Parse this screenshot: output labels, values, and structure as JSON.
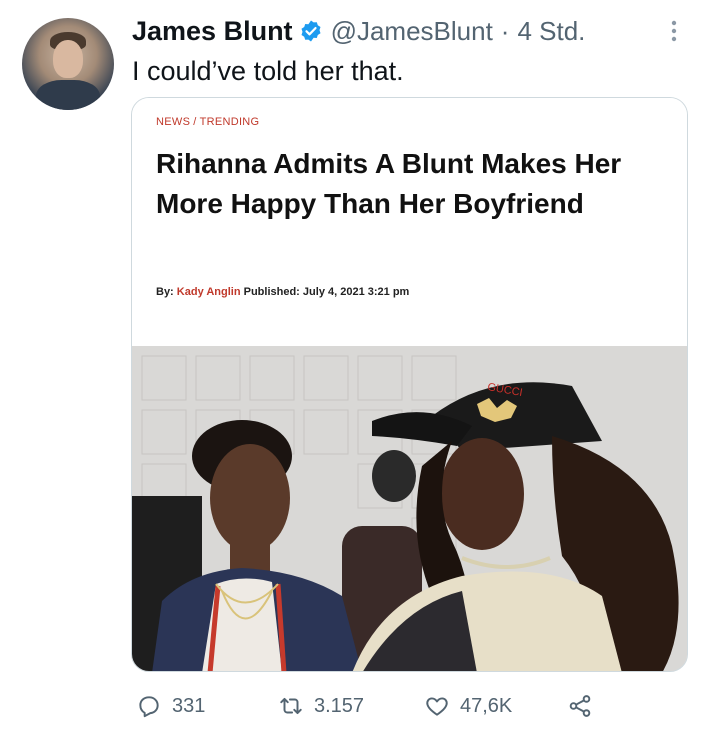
{
  "tweet": {
    "display_name": "James Blunt",
    "handle": "@JamesBlunt",
    "separator": "·",
    "time": "4 Std.",
    "text": "I could’ve told her that."
  },
  "card": {
    "breadcrumb_section": "NEWS",
    "breadcrumb_separator": "/",
    "breadcrumb_category": "TRENDING",
    "headline": "Rihanna Admits A Blunt Makes Her More Happy Than Her Boyfriend",
    "byline_prefix": "By:",
    "author": "Kady Anglin",
    "published_label": "Published:",
    "published_date": "July 4, 2021 3:21 pm",
    "photo_cap_text": "GUCCI"
  },
  "actions": {
    "reply_count": "331",
    "retweet_count": "3.157",
    "like_count": "47,6K"
  },
  "icons": {
    "verified": "verified-badge-icon",
    "more": "more-vertical-icon",
    "reply": "reply-icon",
    "retweet": "retweet-icon",
    "like": "heart-icon",
    "share": "share-icon"
  },
  "colors": {
    "verified_blue": "#1d9bf0",
    "secondary_text": "#536471",
    "accent_red": "#c0392b"
  }
}
